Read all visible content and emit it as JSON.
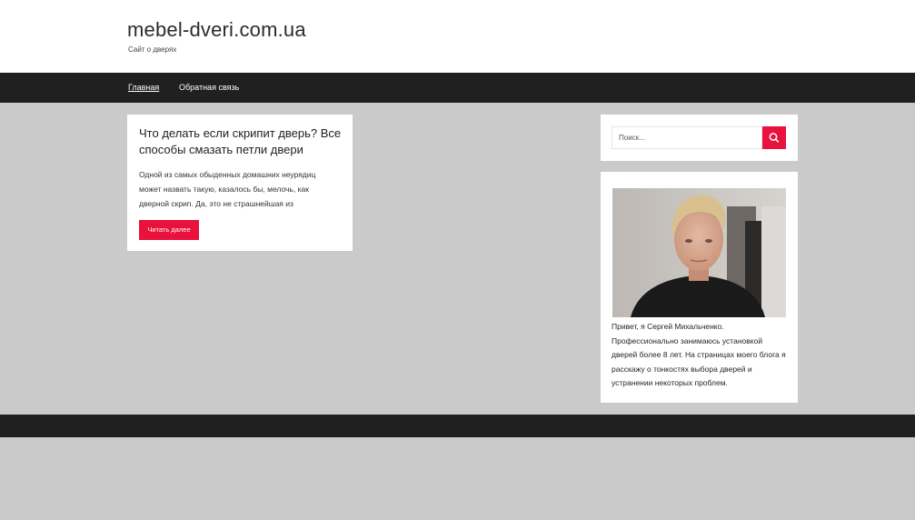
{
  "header": {
    "site_title": "mebel-dveri.com.ua",
    "site_description": "Сайт о дверях"
  },
  "nav": {
    "items": [
      {
        "label": "Главная",
        "active": true
      },
      {
        "label": "Обратная связь",
        "active": false
      }
    ]
  },
  "post": {
    "title": "Что делать если скрипит дверь? Все способы смазать петли двери",
    "excerpt": "Одной из самых обыденных домашних неурядиц может назвать такую, казалось бы, мелочь, как дверной скрип. Да, это не страшнейшая из",
    "read_more_label": "Читать далее"
  },
  "sidebar": {
    "search": {
      "placeholder": "Поиск...",
      "button_icon": "search-icon"
    },
    "about": {
      "text": "Привет, я Сергей Михальченко. Профессионально занимаюсь установкой дверей более 8 лет. На страницах моего блога я расскажу о тонкостях выбора дверей и устранении некоторых проблем."
    }
  },
  "colors": {
    "accent": "#e8123c",
    "nav_background": "#202020",
    "page_background": "#cacaca"
  }
}
